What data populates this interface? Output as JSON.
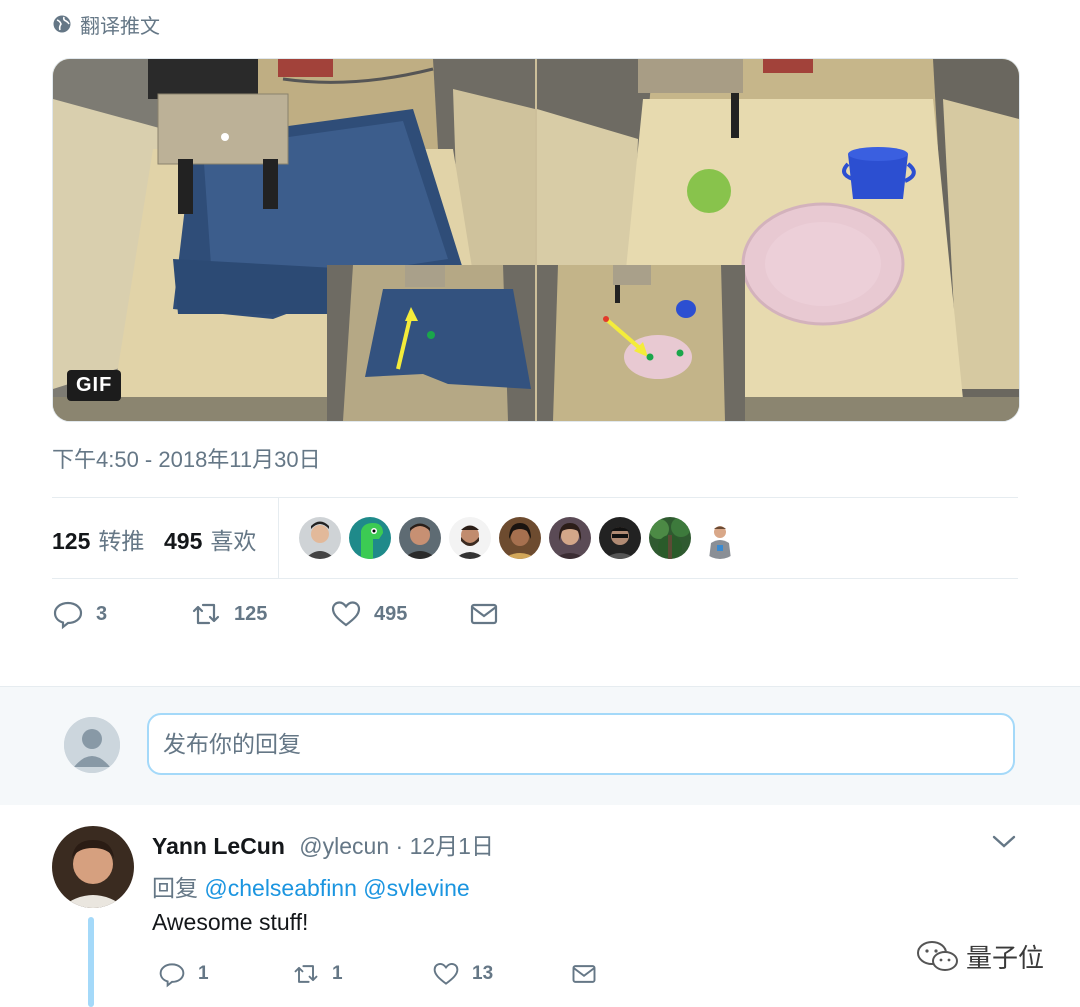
{
  "translate": {
    "label": "翻译推文",
    "icon": "globe-icon"
  },
  "media": {
    "badge": "GIF"
  },
  "tweet": {
    "timestamp": "下午4:50 - 2018年11月30日"
  },
  "stats": {
    "retweets": {
      "count": "125",
      "label": "转推"
    },
    "likes": {
      "count": "495",
      "label": "喜欢"
    }
  },
  "actions": {
    "reply": "3",
    "retweet": "125",
    "like": "495"
  },
  "reply_box": {
    "placeholder": "发布你的回复"
  },
  "reply_tweet": {
    "name": "Yann LeCun",
    "handle": "@ylecun",
    "time": "· 12月1日",
    "replying_label": "回复",
    "mention1": "@chelseabfinn",
    "mention2": "@svlevine",
    "text": "Awesome stuff!",
    "actions": {
      "reply": "1",
      "retweet": "1",
      "like": "13"
    }
  },
  "watermark": {
    "text": "量子位"
  },
  "colors": {
    "accent": "#1b95e0",
    "muted": "#657786",
    "reply_border": "#a4d9f9",
    "bg_soft": "#f5f8fa"
  }
}
